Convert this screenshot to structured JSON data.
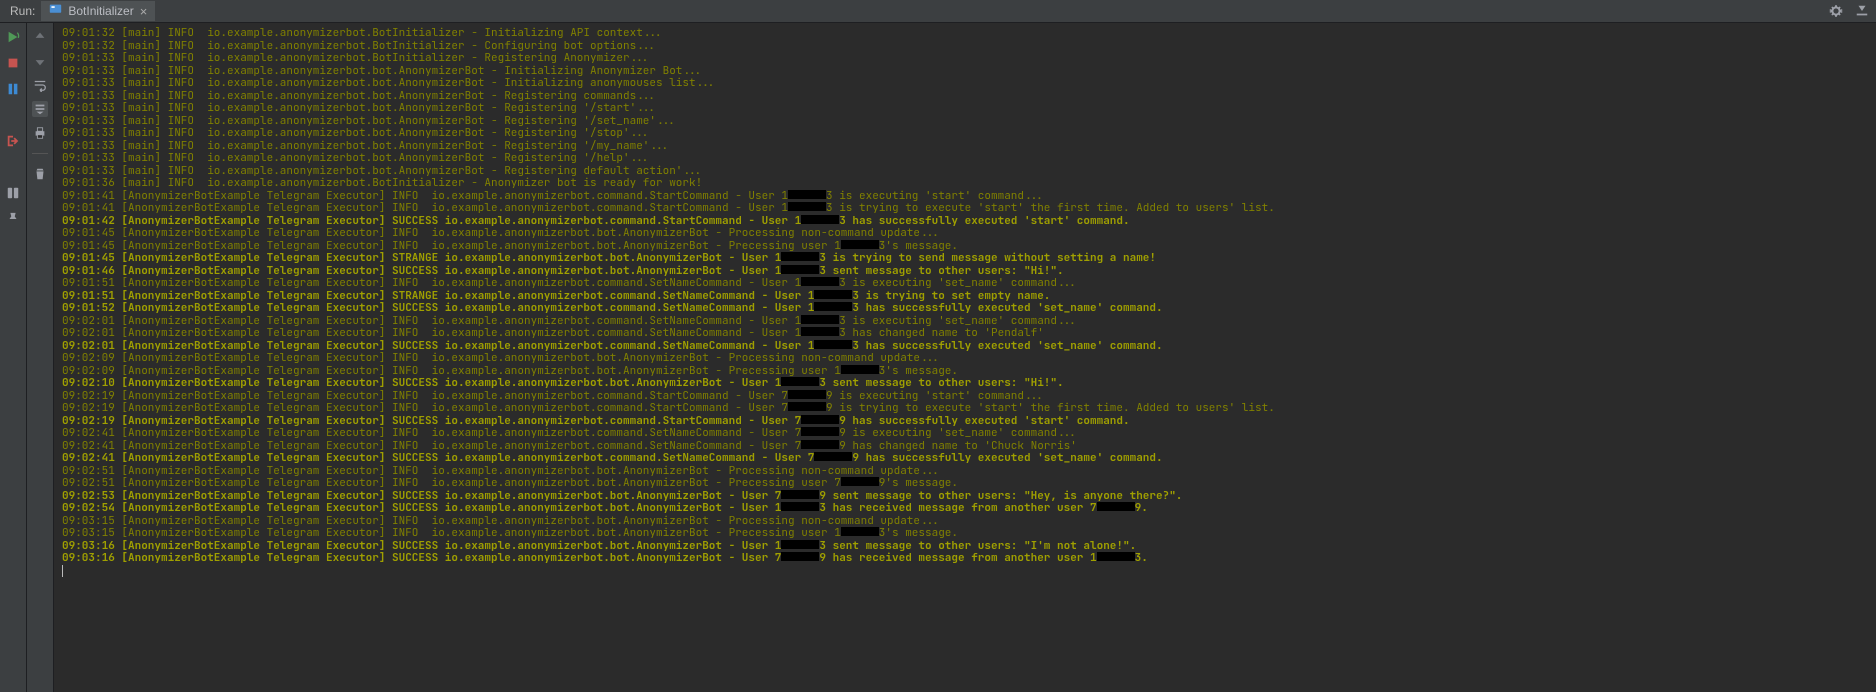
{
  "header": {
    "run_label": "Run:",
    "tab_label": "BotInitializer",
    "close_x": "×"
  },
  "log": [
    {
      "b": false,
      "parts": [
        "09:01:32 [main] INFO  io.example.anonymizerbot.BotInitializer - Initializing API context..."
      ]
    },
    {
      "b": false,
      "parts": [
        "09:01:32 [main] INFO  io.example.anonymizerbot.BotInitializer - Configuring bot options..."
      ]
    },
    {
      "b": false,
      "parts": [
        "09:01:33 [main] INFO  io.example.anonymizerbot.BotInitializer - Registering Anonymizer..."
      ]
    },
    {
      "b": false,
      "parts": [
        "09:01:33 [main] INFO  io.example.anonymizerbot.bot.AnonymizerBot - Initializing Anonymizer Bot..."
      ]
    },
    {
      "b": false,
      "parts": [
        "09:01:33 [main] INFO  io.example.anonymizerbot.bot.AnonymizerBot - Initializing anonymouses list..."
      ]
    },
    {
      "b": false,
      "parts": [
        "09:01:33 [main] INFO  io.example.anonymizerbot.bot.AnonymizerBot - Registering commands..."
      ]
    },
    {
      "b": false,
      "parts": [
        "09:01:33 [main] INFO  io.example.anonymizerbot.bot.AnonymizerBot - Registering '/start'..."
      ]
    },
    {
      "b": false,
      "parts": [
        "09:01:33 [main] INFO  io.example.anonymizerbot.bot.AnonymizerBot - Registering '/set_name'..."
      ]
    },
    {
      "b": false,
      "parts": [
        "09:01:33 [main] INFO  io.example.anonymizerbot.bot.AnonymizerBot - Registering '/stop'..."
      ]
    },
    {
      "b": false,
      "parts": [
        "09:01:33 [main] INFO  io.example.anonymizerbot.bot.AnonymizerBot - Registering '/my_name'..."
      ]
    },
    {
      "b": false,
      "parts": [
        "09:01:33 [main] INFO  io.example.anonymizerbot.bot.AnonymizerBot - Registering '/help'..."
      ]
    },
    {
      "b": false,
      "parts": [
        "09:01:33 [main] INFO  io.example.anonymizerbot.bot.AnonymizerBot - Registering default action'..."
      ]
    },
    {
      "b": false,
      "parts": [
        "09:01:36 [main] INFO  io.example.anonymizerbot.BotInitializer - Anonymizer bot is ready for work!"
      ]
    },
    {
      "b": false,
      "parts": [
        "09:01:41 [AnonymizerBotExample Telegram Executor] INFO  io.example.anonymizerbot.command.StartCommand - User 1",
        "R",
        "3 is executing 'start' command..."
      ]
    },
    {
      "b": false,
      "parts": [
        "09:01:41 [AnonymizerBotExample Telegram Executor] INFO  io.example.anonymizerbot.command.StartCommand - User 1",
        "R",
        "3 is trying to execute 'start' the first time. Added to users' list."
      ]
    },
    {
      "b": true,
      "parts": [
        "09:01:42 [AnonymizerBotExample Telegram Executor] SUCCESS io.example.anonymizerbot.command.StartCommand - User 1",
        "R",
        "3 has successfully executed 'start' command."
      ]
    },
    {
      "b": false,
      "parts": [
        "09:01:45 [AnonymizerBotExample Telegram Executor] INFO  io.example.anonymizerbot.bot.AnonymizerBot - Processing non-command update..."
      ]
    },
    {
      "b": false,
      "parts": [
        "09:01:45 [AnonymizerBotExample Telegram Executor] INFO  io.example.anonymizerbot.bot.AnonymizerBot - Precessing user 1",
        "R",
        "3's message."
      ]
    },
    {
      "b": true,
      "parts": [
        "09:01:45 [AnonymizerBotExample Telegram Executor] STRANGE io.example.anonymizerbot.bot.AnonymizerBot - User 1",
        "R",
        "3 is trying to send message without setting a name!"
      ]
    },
    {
      "b": true,
      "parts": [
        "09:01:46 [AnonymizerBotExample Telegram Executor] SUCCESS io.example.anonymizerbot.bot.AnonymizerBot - User 1",
        "R",
        "3 sent message to other users: \"Hi!\"."
      ]
    },
    {
      "b": false,
      "parts": [
        "09:01:51 [AnonymizerBotExample Telegram Executor] INFO  io.example.anonymizerbot.command.SetNameCommand - User 1",
        "R",
        "3 is executing 'set_name' command..."
      ]
    },
    {
      "b": true,
      "parts": [
        "09:01:51 [AnonymizerBotExample Telegram Executor] STRANGE io.example.anonymizerbot.command.SetNameCommand - User 1",
        "R",
        "3 is trying to set empty name."
      ]
    },
    {
      "b": true,
      "parts": [
        "09:01:52 [AnonymizerBotExample Telegram Executor] SUCCESS io.example.anonymizerbot.command.SetNameCommand - User 1",
        "R",
        "3 has successfully executed 'set_name' command."
      ]
    },
    {
      "b": false,
      "parts": [
        "09:02:01 [AnonymizerBotExample Telegram Executor] INFO  io.example.anonymizerbot.command.SetNameCommand - User 1",
        "R",
        "3 is executing 'set_name' command..."
      ]
    },
    {
      "b": false,
      "parts": [
        "09:02:01 [AnonymizerBotExample Telegram Executor] INFO  io.example.anonymizerbot.command.SetNameCommand - User 1",
        "R",
        "3 has changed name to 'Pendalf'"
      ]
    },
    {
      "b": true,
      "parts": [
        "09:02:01 [AnonymizerBotExample Telegram Executor] SUCCESS io.example.anonymizerbot.command.SetNameCommand - User 1",
        "R",
        "3 has successfully executed 'set_name' command."
      ]
    },
    {
      "b": false,
      "parts": [
        "09:02:09 [AnonymizerBotExample Telegram Executor] INFO  io.example.anonymizerbot.bot.AnonymizerBot - Processing non-command update..."
      ]
    },
    {
      "b": false,
      "parts": [
        "09:02:09 [AnonymizerBotExample Telegram Executor] INFO  io.example.anonymizerbot.bot.AnonymizerBot - Precessing user 1",
        "R",
        "3's message."
      ]
    },
    {
      "b": true,
      "parts": [
        "09:02:10 [AnonymizerBotExample Telegram Executor] SUCCESS io.example.anonymizerbot.bot.AnonymizerBot - User 1",
        "R",
        "3 sent message to other users: \"Hi!\"."
      ]
    },
    {
      "b": false,
      "parts": [
        "09:02:19 [AnonymizerBotExample Telegram Executor] INFO  io.example.anonymizerbot.command.StartCommand - User 7",
        "R",
        "9 is executing 'start' command..."
      ]
    },
    {
      "b": false,
      "parts": [
        "09:02:19 [AnonymizerBotExample Telegram Executor] INFO  io.example.anonymizerbot.command.StartCommand - User 7",
        "R",
        "9 is trying to execute 'start' the first time. Added to users' list."
      ]
    },
    {
      "b": true,
      "parts": [
        "09:02:19 [AnonymizerBotExample Telegram Executor] SUCCESS io.example.anonymizerbot.command.StartCommand - User 7",
        "R",
        "9 has successfully executed 'start' command."
      ]
    },
    {
      "b": false,
      "parts": [
        "09:02:41 [AnonymizerBotExample Telegram Executor] INFO  io.example.anonymizerbot.command.SetNameCommand - User 7",
        "R",
        "9 is executing 'set_name' command..."
      ]
    },
    {
      "b": false,
      "parts": [
        "09:02:41 [AnonymizerBotExample Telegram Executor] INFO  io.example.anonymizerbot.command.SetNameCommand - User 7",
        "R",
        "9 has changed name to 'Chuck Norris'"
      ]
    },
    {
      "b": true,
      "parts": [
        "09:02:41 [AnonymizerBotExample Telegram Executor] SUCCESS io.example.anonymizerbot.command.SetNameCommand - User 7",
        "R",
        "9 has successfully executed 'set_name' command."
      ]
    },
    {
      "b": false,
      "parts": [
        "09:02:51 [AnonymizerBotExample Telegram Executor] INFO  io.example.anonymizerbot.bot.AnonymizerBot - Processing non-command update..."
      ]
    },
    {
      "b": false,
      "parts": [
        "09:02:51 [AnonymizerBotExample Telegram Executor] INFO  io.example.anonymizerbot.bot.AnonymizerBot - Precessing user 7",
        "R",
        "9's message."
      ]
    },
    {
      "b": true,
      "parts": [
        "09:02:53 [AnonymizerBotExample Telegram Executor] SUCCESS io.example.anonymizerbot.bot.AnonymizerBot - User 7",
        "R",
        "9 sent message to other users: \"Hey, is anyone there?\"."
      ]
    },
    {
      "b": true,
      "parts": [
        "09:02:54 [AnonymizerBotExample Telegram Executor] SUCCESS io.example.anonymizerbot.bot.AnonymizerBot - User 1",
        "R",
        "3 has received message from another user 7",
        "R",
        "9."
      ]
    },
    {
      "b": false,
      "parts": [
        "09:03:15 [AnonymizerBotExample Telegram Executor] INFO  io.example.anonymizerbot.bot.AnonymizerBot - Processing non-command update..."
      ]
    },
    {
      "b": false,
      "parts": [
        "09:03:15 [AnonymizerBotExample Telegram Executor] INFO  io.example.anonymizerbot.bot.AnonymizerBot - Precessing user 1",
        "R",
        "3's message."
      ]
    },
    {
      "b": true,
      "parts": [
        "09:03:16 [AnonymizerBotExample Telegram Executor] SUCCESS io.example.anonymizerbot.bot.AnonymizerBot - User 1",
        "R",
        "3 sent message to other users: \"I'm not alone!\"."
      ]
    },
    {
      "b": true,
      "parts": [
        "09:03:16 [AnonymizerBotExample Telegram Executor] SUCCESS io.example.anonymizerbot.bot.AnonymizerBot - User 7",
        "R",
        "9 has received message from another user 1",
        "R",
        "3."
      ]
    }
  ]
}
